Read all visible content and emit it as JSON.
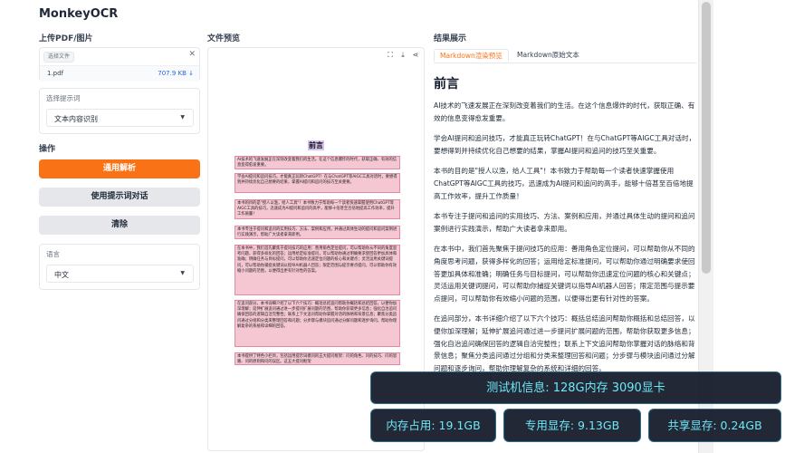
{
  "app": {
    "title": "MonkeyOCR"
  },
  "left": {
    "upload_label": "上传PDF/图片",
    "upload_chip": "选择文件",
    "file": {
      "name": "1.pdf",
      "size": "707.9 KB ↓"
    },
    "prompt_panel": {
      "title": "选择提示词",
      "selected": "文本内容识别"
    },
    "actions_label": "操作",
    "buttons": {
      "parse": "通用解析",
      "prompt_chat": "使用提示词对话",
      "clear": "清除"
    },
    "language_panel": {
      "title": "语言",
      "selected": "中文"
    }
  },
  "middle": {
    "title": "文件预览",
    "pdf": {
      "heading": "前言",
      "blocks": [
        "AI技术的飞速发展正在深刻改变着我们的生活。在这个信息爆炸的时代，获取正确、有效的信息变得愈发重要。",
        "学会AI提问和追问技巧，才能真正玩转ChatGPT！在与ChatGPT等AIGC工具对话时，要想得到并持续优化自己想要的结果，掌握AI提问和追问的技巧至关重要。",
        "本书的目的是\"授人以渔，给人工具\"！本书致力于帮助每一个读者快速掌握使用ChatGPT等AIGC工具的技巧，迅速成为AI提问和追问的高手，能够十倍甚至百倍地提高工作效率，提升工作质量！",
        "本书专注于提问和追问的实用技巧、方法、案例和应用，并通过具体生动的提问和追问案例进行实践演示，帮助广大读者拿来即用。",
        "在本书中，我们首先聚焦于提问技巧的应用：善用角色定位提问，可以帮助你从不同的角度思考问题，获得多样化的回答；运用给定标准提问，可以帮助你通过明确要求使回答更加具体和准确；明确任务与目标提问，可以帮助你迅速定位问题的核心和关键点；灵活运用关键词提问，可以帮助你捕捉关键词以指导AI机器人回答；限定范围与提示要点提问，可以帮助你有效缩小问题的范围，以便得出更有针对性的答案。",
        "在追问部分，本书详细介绍了以下六个技巧：概括总结追问帮助你概括和总结回答，以便你加深理解；延伸扩展追问通过进一步提问扩展问题的范围，帮助你获取更多信息；强化自治追问确保回答的逻辑自洽完整性；联系上下文追问帮助你掌握对话的脉络和背景信息；聚焦分类追问通过分组和分类来整理回答和问题；分步骤与模块追问通过分解问题和逐步询问，帮助你理解复杂的系统和详细的回答。",
        "本书提供了特色小栏目，包括运用提示词模问的五大提问框架：问的角色、问的技巧、问的思路、问的原则和问的误区。这五大提问框架"
      ]
    }
  },
  "right": {
    "title": "结果展示",
    "tabs": [
      "Markdown渲染预览",
      "Markdown原始文本"
    ],
    "active_tab": 0,
    "md_heading": "前言",
    "paragraphs": [
      "AI技术的飞速发展正在深刻改变着我们的生活。在这个信息爆炸的时代，获取正确、有效的信息变得愈发重要。",
      "学会AI提问和追问技巧，才能真正玩转ChatGPT！在与ChatGPT等AIGC工具对话时，要想得到并持续优化自己想要的结果，掌握AI提问和追问的技巧至关重要。",
      "本书的目的是\"授人以渔，给人工具\"！本书致力于帮助每一个读者快速掌握使用ChatGPT等AIGC工具的技巧，迅速成为AI提问和追问的高手，能够十倍甚至百倍地提高工作效率，提升工作质量！",
      "本书专注于提问和追问的实用技巧、方法、案例和应用，并通过具体生动的提问和追问案例进行实践演示，帮助广大读者拿来即用。",
      "在本书中，我们首先聚焦于提问技巧的应用：善用角色定位提问，可以帮助你从不同的角度思考问题，获得多样化的回答；运用给定标准提问，可以帮助你通过明确要求使回答更加具体和准确；明确任务与目标提问，可以帮助你迅速定位问题的核心和关键点；灵活运用关键词提问，可以帮助你捕捉关键词以指导AI机器人回答；限定范围与提示要点提问，可以帮助你有效缩小问题的范围，以便得出更有针对性的答案。",
      "在追问部分，本书详细介绍了以下六个技巧：概括总结追问帮助你概括和总结回答，以便你加深理解；延伸扩展追问通过进一步提问扩展问题的范围，帮助你获取更多信息；强化自治追问确保回答的逻辑自洽完整性；联系上下文追问帮助你掌握对话的脉络和背景信息；聚焦分类追问通过分组和分类来整理回答和问题；分步骤与模块追问通过分解问题和逐步询问，帮助你理解复杂的系统和详细的回答。"
    ]
  },
  "overlay": {
    "test_machine": "测试机信息: 128G内存  3090显卡",
    "mem_usage": "内存占用: 19.1GB",
    "gpu_mem": "专用显存: 9.13GB",
    "shared_mem": "共享显存: 0.24GB"
  },
  "colors": {
    "accent": "#f97316",
    "overlay_text": "#6ee7f5",
    "highlight": "#f4c7d2"
  },
  "icons": [
    "close-icon",
    "download-icon",
    "fullscreen-icon",
    "share-icon",
    "chevron-down-icon"
  ]
}
